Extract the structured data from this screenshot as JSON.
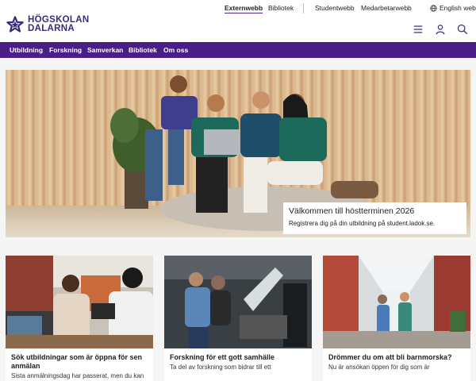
{
  "header": {
    "logo": {
      "line1": "HÖGSKOLAN",
      "line2": "DALARNA"
    },
    "toplinks": {
      "externwebb": "Externwebb",
      "bibliotek": "Bibliotek",
      "studentwebb": "Studentwebb",
      "medarbetarwebb": "Medarbetarwebb",
      "language": "English web"
    },
    "icons": [
      "menu-icon",
      "user-icon",
      "search-icon"
    ]
  },
  "nav": {
    "items": [
      "Utbildning",
      "Forskning",
      "Samverkan",
      "Bibliotek",
      "Om oss"
    ]
  },
  "hero": {
    "title": "Välkommen till höstterminen 2026",
    "subtitle": "Registrera dig på din utbildning på student.ladok.se."
  },
  "cards": [
    {
      "title": "Sök utbildningar som är öppna för sen anmälan",
      "text": "Sista anmälningsdag har passerat, men du kan"
    },
    {
      "title": "Forskning för ett gott samhälle",
      "text": "Ta del av forskning som bidrar till ett"
    },
    {
      "title": "Drömmer du om att bli barnmorska?",
      "text": "Nu är ansökan öppen för dig som är"
    }
  ],
  "colors": {
    "brand_purple": "#4a1e86",
    "logo_purple": "#3d2a7a"
  }
}
